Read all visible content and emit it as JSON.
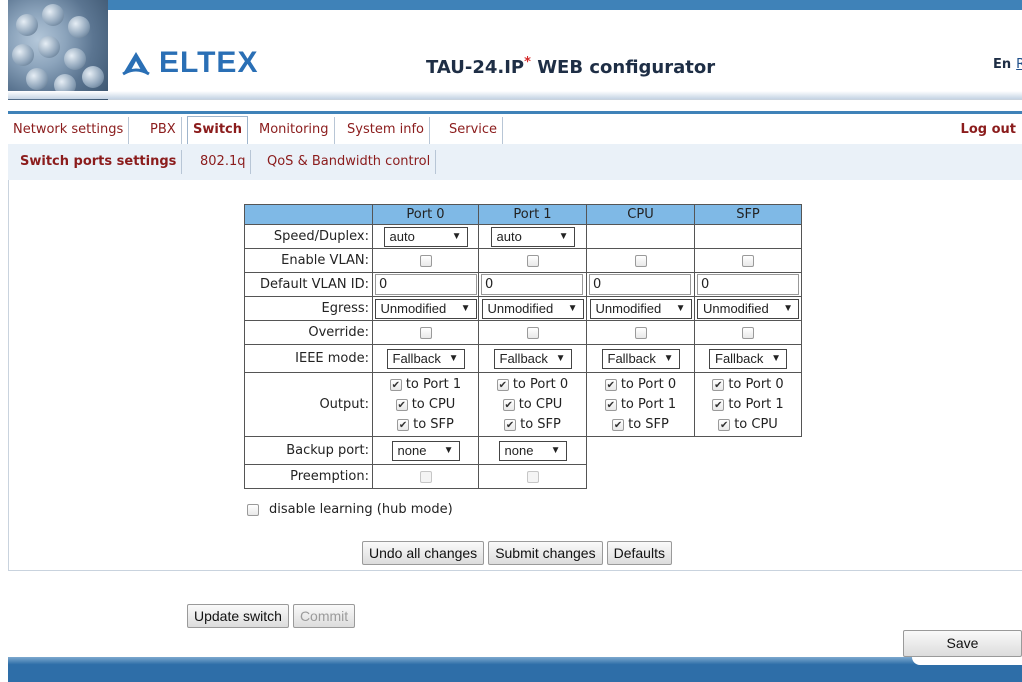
{
  "header": {
    "logo_text": "ELTEX",
    "title_main": "TAU-24.IP",
    "title_star": "*",
    "title_rest": " WEB configurator",
    "lang_current": "En",
    "lang_other": "Ru"
  },
  "menu": {
    "items": [
      "Network settings",
      "PBX",
      "Switch",
      "Monitoring",
      "System info",
      "Service"
    ],
    "active": "Switch",
    "logout": "Log out"
  },
  "submenu": {
    "items": [
      "Switch ports settings",
      "802.1q",
      "QoS & Bandwidth control"
    ],
    "active": "Switch ports settings"
  },
  "ports_table": {
    "columns": [
      "Port 0",
      "Port 1",
      "CPU",
      "SFP"
    ],
    "labels": {
      "speed": "Speed/Duplex:",
      "vlan": "Enable VLAN:",
      "vlan_id": "Default VLAN ID:",
      "egress": "Egress:",
      "override": "Override:",
      "ieee": "IEEE mode:",
      "output": "Output:",
      "backup": "Backup port:",
      "preemption": "Preemption:"
    },
    "speed": [
      "auto",
      "auto"
    ],
    "vlan_id": [
      "0",
      "0",
      "0",
      "0"
    ],
    "egress": [
      "Unmodified",
      "Unmodified",
      "Unmodified",
      "Unmodified"
    ],
    "ieee": [
      "Fallback",
      "Fallback",
      "Fallback",
      "Fallback"
    ],
    "output": [
      [
        "to Port 1",
        "to CPU",
        "to SFP"
      ],
      [
        "to Port 0",
        "to CPU",
        "to SFP"
      ],
      [
        "to Port 0",
        "to Port 1",
        "to SFP"
      ],
      [
        "to Port 0",
        "to Port 1",
        "to CPU"
      ]
    ],
    "backup": [
      "none",
      "none"
    ]
  },
  "hub_label": "disable learning (hub mode)",
  "buttons": {
    "undo": "Undo all changes",
    "submit": "Submit changes",
    "defaults": "Defaults",
    "update": "Update switch",
    "commit": "Commit",
    "save": "Save"
  },
  "colors": {
    "accent": "#3f82b8",
    "table_header": "#7fb9e6",
    "menu_text": "#8b1c1c"
  }
}
